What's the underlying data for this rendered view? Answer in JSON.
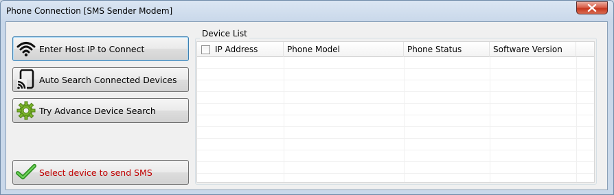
{
  "window": {
    "title": "Phone Connection [SMS Sender Modem]",
    "close_icon": "close-icon"
  },
  "buttons": {
    "enter_host": {
      "label": "Enter Host IP to Connect",
      "icon": "wifi-icon"
    },
    "auto_search": {
      "label": "Auto Search Connected Devices",
      "icon": "cast-device-icon"
    },
    "advance_search": {
      "label": "Try Advance Device Search",
      "icon": "gear-icon"
    },
    "select_device": {
      "label": "Select device to send SMS",
      "icon": "checkmark-icon",
      "color": "#c00000"
    }
  },
  "device_list": {
    "title": "Device List",
    "columns": [
      "IP Address",
      "Phone Model",
      "Phone Status",
      "Software Version"
    ],
    "select_all_checked": false,
    "rows": []
  },
  "colors": {
    "accent": "#3c7fb1",
    "close": "#c6371f",
    "check_green": "#3aa52b"
  }
}
